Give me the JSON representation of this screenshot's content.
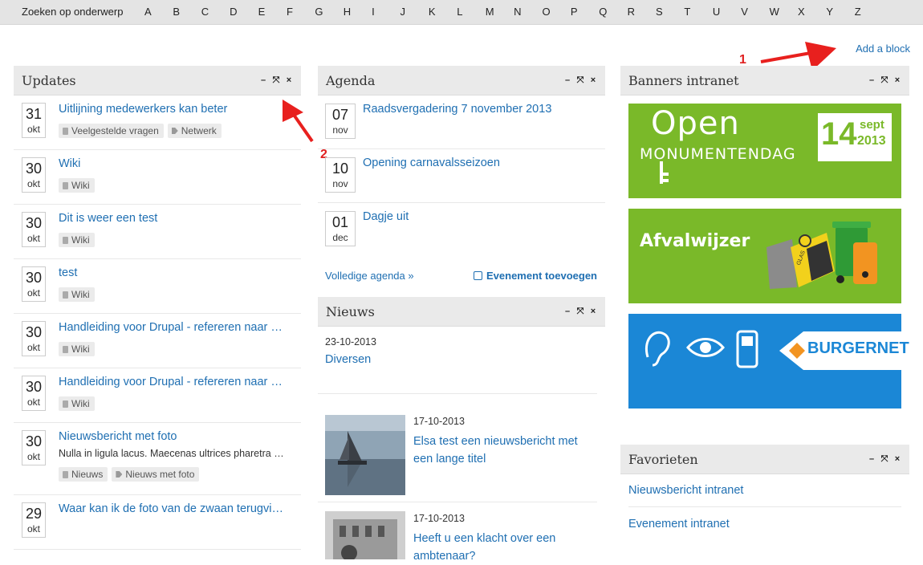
{
  "alpha_nav": {
    "label": "Zoeken op onderwerp",
    "letters": [
      "A",
      "B",
      "C",
      "D",
      "E",
      "F",
      "G",
      "H",
      "I",
      "J",
      "K",
      "L",
      "M",
      "N",
      "O",
      "P",
      "Q",
      "R",
      "S",
      "T",
      "U",
      "V",
      "W",
      "X",
      "Y",
      "Z"
    ]
  },
  "add_block": "Add a block",
  "annotations": [
    "1",
    "2"
  ],
  "block_controls": {
    "minimize": "–",
    "expand": "⤧",
    "close": "×"
  },
  "updates": {
    "title": "Updates",
    "items": [
      {
        "day": "31",
        "month": "okt",
        "title": "Uitlijning medewerkers kan beter",
        "tags": [
          "Veelgestelde vragen",
          "Netwerk"
        ]
      },
      {
        "day": "30",
        "month": "okt",
        "title": "Wiki",
        "tags": [
          "Wiki"
        ]
      },
      {
        "day": "30",
        "month": "okt",
        "title": "Dit is weer een test",
        "tags": [
          "Wiki"
        ]
      },
      {
        "day": "30",
        "month": "okt",
        "title": "test",
        "tags": [
          "Wiki"
        ]
      },
      {
        "day": "30",
        "month": "okt",
        "title": "Handleiding voor Drupal - refereren naar …",
        "tags": [
          "Wiki"
        ]
      },
      {
        "day": "30",
        "month": "okt",
        "title": "Handleiding voor Drupal - refereren naar …",
        "tags": [
          "Wiki"
        ]
      },
      {
        "day": "30",
        "month": "okt",
        "title": "Nieuwsbericht met foto",
        "desc": "Nulla in ligula lacus. Maecenas ultrices pharetra …",
        "tags": [
          "Nieuws",
          "Nieuws met foto"
        ]
      },
      {
        "day": "29",
        "month": "okt",
        "title": "Waar kan ik de foto van de zwaan terugvi…",
        "tags": []
      }
    ]
  },
  "agenda": {
    "title": "Agenda",
    "items": [
      {
        "day": "07",
        "month": "nov",
        "title": "Raadsvergadering 7 november 2013"
      },
      {
        "day": "10",
        "month": "nov",
        "title": "Opening carnavalsseizoen"
      },
      {
        "day": "01",
        "month": "dec",
        "title": "Dagje uit"
      }
    ],
    "full_link": "Volledige agenda »",
    "add_event": "Evenement toevoegen"
  },
  "nieuws": {
    "title": "Nieuws",
    "items": [
      {
        "date": "23-10-2013",
        "title": "Diversen"
      },
      {
        "date": "17-10-2013",
        "title_lines": [
          "Elsa test een nieuwsbericht met",
          "een lange titel"
        ]
      },
      {
        "date": "17-10-2013",
        "title_lines": [
          "Heeft u een klacht over een",
          "ambtenaar?"
        ]
      }
    ]
  },
  "banners": {
    "title": "Banners intranet",
    "items": [
      {
        "name": "open-monumentendag",
        "line1": "Open",
        "line2": "MONUMENTENDAG",
        "day": "14",
        "month": "sept",
        "year": "2013",
        "bg": "#7ab929"
      },
      {
        "name": "afvalwijzer",
        "text": "Afvalwijzer",
        "glas": "GLAS",
        "bg": "#7ab929"
      },
      {
        "name": "burgernet",
        "text": "BURGERNET",
        "bg": "#1b87d6"
      }
    ]
  },
  "favorieten": {
    "title": "Favorieten",
    "links": [
      "Nieuwsbericht intranet",
      "Evenement intranet"
    ]
  }
}
